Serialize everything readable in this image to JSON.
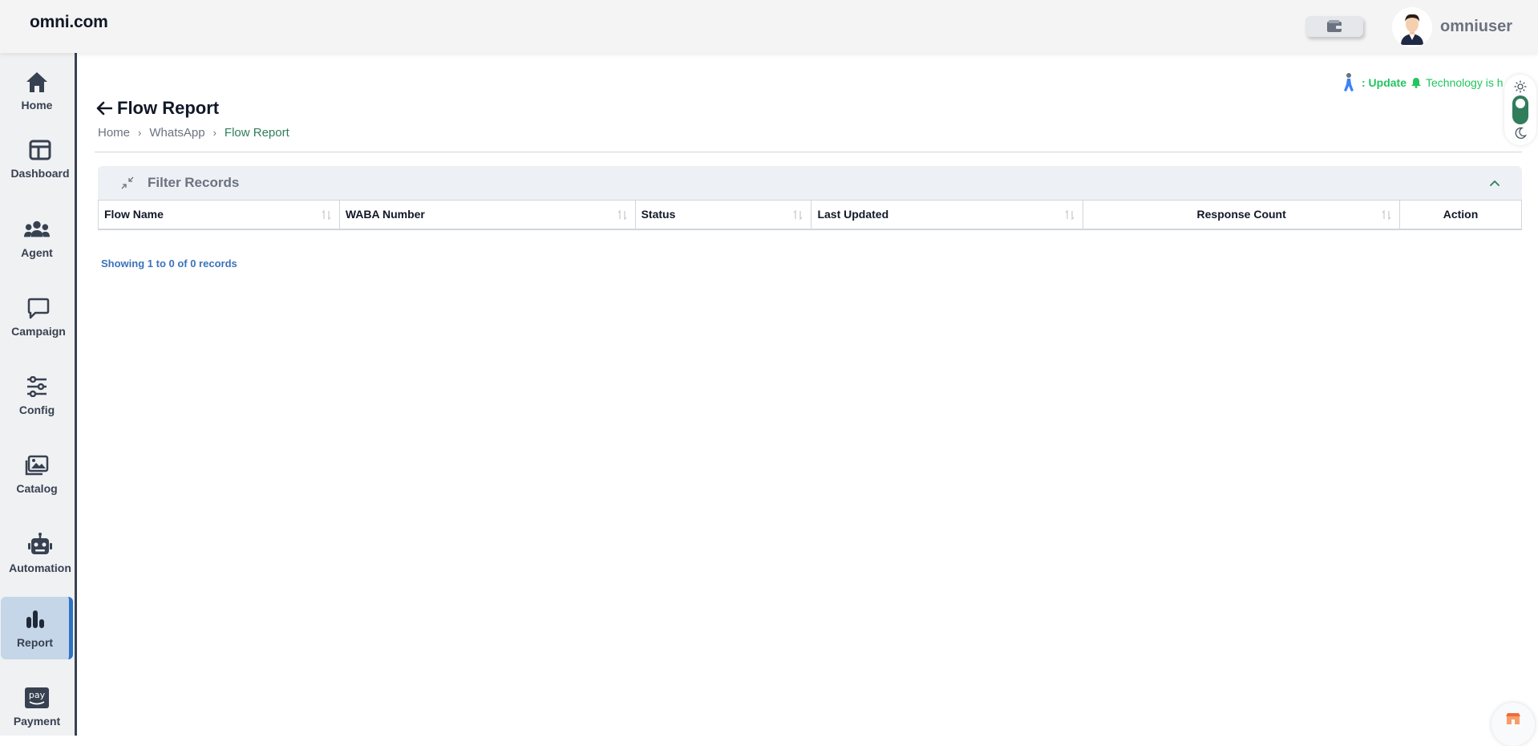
{
  "header": {
    "logo": "omni.com",
    "username": "omniuser"
  },
  "sidebar": {
    "items": [
      {
        "label": "Home",
        "icon": "home-icon"
      },
      {
        "label": "Dashboard",
        "icon": "dashboard-icon"
      },
      {
        "label": "Agent",
        "icon": "agents-icon"
      },
      {
        "label": "Campaign",
        "icon": "chat-bubble-icon"
      },
      {
        "label": "Config",
        "icon": "sliders-icon"
      },
      {
        "label": "Catalog",
        "icon": "image-icon"
      },
      {
        "label": "Automation",
        "icon": "robot-icon"
      },
      {
        "label": "Report",
        "icon": "bar-chart-icon"
      },
      {
        "label": "Payment",
        "icon": "amazon-pay-icon"
      }
    ],
    "active": "Report"
  },
  "notice": {
    "label": ": Update",
    "text": "Technology is h"
  },
  "page": {
    "title": "Flow Report",
    "breadcrumb": [
      "Home",
      "WhatsApp",
      "Flow Report"
    ]
  },
  "filter": {
    "title": "Filter Records"
  },
  "table": {
    "columns": [
      "Flow Name",
      "WABA Number",
      "Status",
      "Last Updated",
      "Response Count",
      "Action"
    ],
    "rows": []
  },
  "pagination": {
    "summary": "Showing 1 to 0 of 0 records"
  },
  "colors": {
    "accent": "#2f7d5b",
    "active_nav": "#c5d6e8",
    "active_nav_border": "#2e72c2",
    "link_blue": "#3b73b9",
    "notice_green": "#22c55e"
  }
}
